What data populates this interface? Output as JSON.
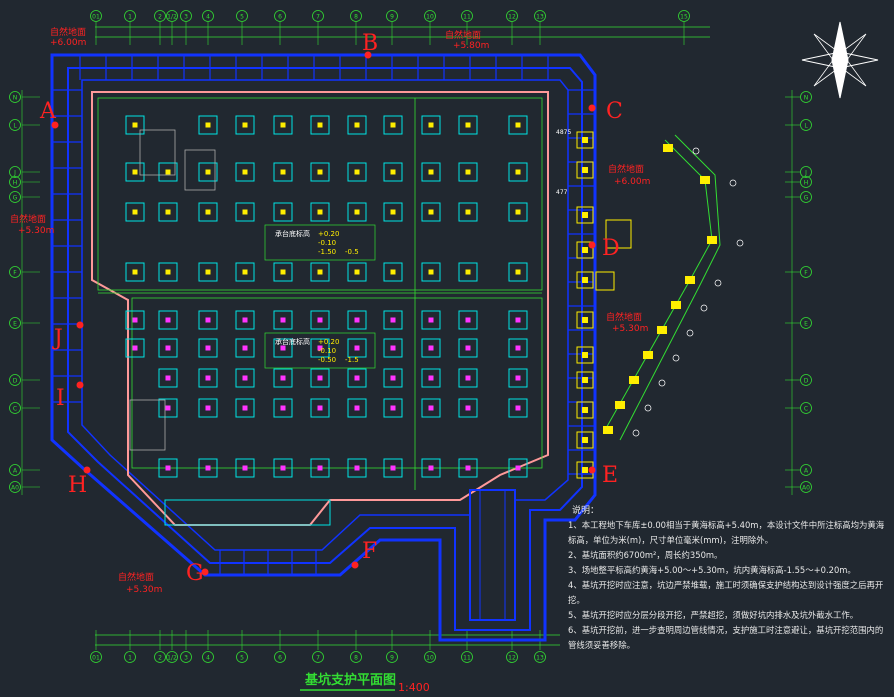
{
  "drawing": {
    "title": "基坑支护平面图",
    "scale": "1:400"
  },
  "axes": {
    "top": [
      "01",
      "1",
      "2",
      "1/2",
      "3",
      "4",
      "5",
      "6",
      "7",
      "8",
      "9",
      "10",
      "11",
      "12",
      "13",
      "15"
    ],
    "left": [
      "N",
      "L",
      "J",
      "H",
      "G",
      "F",
      "E",
      "D",
      "C",
      "A",
      "A0"
    ]
  },
  "section_points": [
    "A",
    "B",
    "C",
    "D",
    "E",
    "F",
    "G",
    "H",
    "I",
    "J"
  ],
  "elevation_labels": {
    "natural_ground": "自然地面",
    "elev_top_left": "+6.00m",
    "elev_top_right": "+5.80m",
    "elev_left": "+5.30m",
    "elev_right_upper": "+6.00m",
    "elev_right_lower": "+5.30m",
    "elev_bottom_left": "+5.30m"
  },
  "pit_labels": {
    "zone_upper": "承台底标高",
    "zone_lower": "承台底标高",
    "note_upper_1": "+0.20",
    "note_upper_2": "-0.10",
    "note_upper_3": "-1.50",
    "note_upper_4": "-0.5",
    "note_lower_1": "+0.20",
    "note_lower_2": "-0.10",
    "note_lower_3": "-0.50",
    "note_lower_4": "-1.5",
    "dim_1": "4875",
    "dim_2": "477"
  },
  "notes": {
    "heading": "说明：",
    "n1": "1、本工程地下车库±0.00相当于黄海标高+5.40m，本设计文件中所注标高均为黄海标高，单位为米(m)，尺寸单位毫米(mm)，注明除外。",
    "n2": "2、基坑面积约6700m²，周长约350m。",
    "n3": "3、场地整平标高约黄海+5.00～+5.30m，坑内黄海标高-1.55～+0.20m。",
    "n4": "4、基坑开挖时应注意，坑边严禁堆载，施工时须确保支护结构达到设计强度之后再开挖。",
    "n5": "5、基坑开挖时应分层分段开挖，严禁超挖，须做好坑内排水及坑外截水工作。",
    "n6": "6、基坑开挖前，进一步查明周边管线情况，支护施工时注意避让，基坑开挖范围内的管线须妥善移除。"
  },
  "colors": {
    "background": "#212830",
    "support_blue": "#1133ff",
    "pit_outline": "#ff9999",
    "pile_cyan": "#00e5e5",
    "pile_dot_yellow": "#ffee00",
    "pile_dot_magenta": "#ff33ff",
    "label_red": "#ff2222",
    "grid_green": "#33dd33",
    "text_white": "#e8e8e8"
  }
}
